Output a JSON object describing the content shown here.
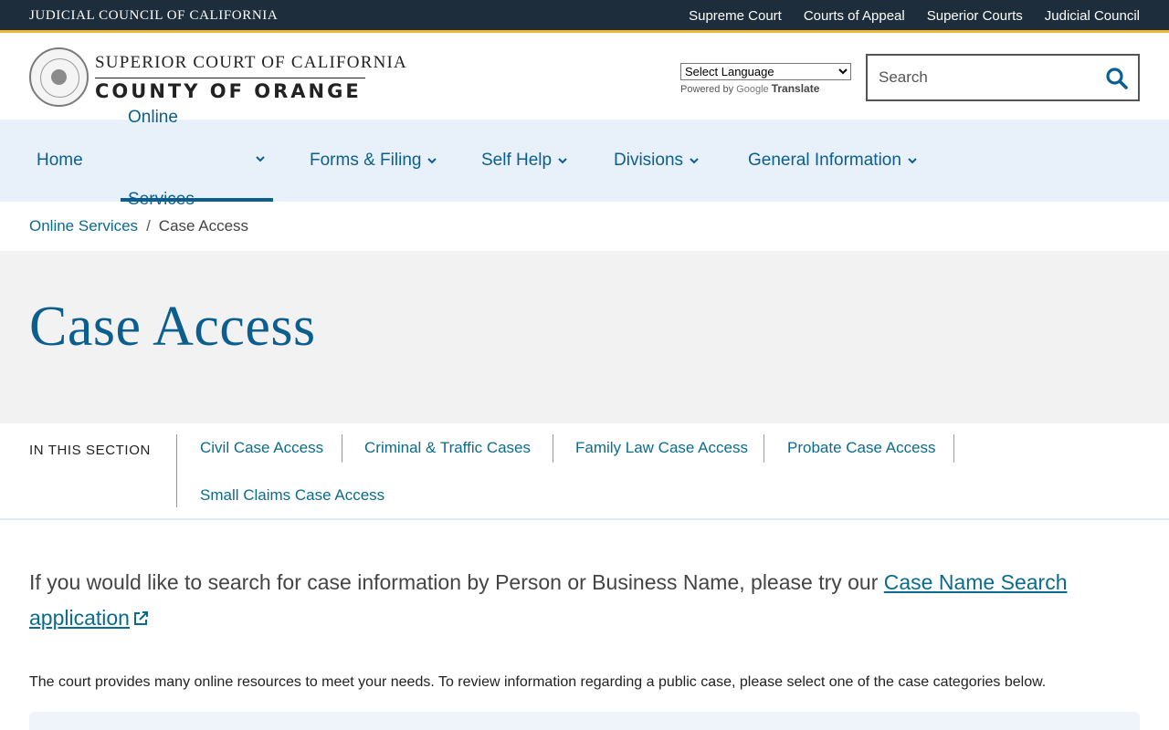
{
  "topbar": {
    "title": "JUDICIAL COUNCIL OF CALIFORNIA",
    "links": [
      "Supreme Court",
      "Courts of Appeal",
      "Superior Courts",
      "Judicial Council"
    ]
  },
  "header": {
    "logo_line1": "SUPERIOR COURT OF CALIFORNIA",
    "logo_line2": "COUNTY OF ORANGE",
    "language_select": "Select Language",
    "powered_by": "Powered by",
    "google": "Google",
    "translate": "Translate",
    "search_placeholder": "Search"
  },
  "nav": {
    "items": [
      {
        "label": "Home"
      },
      {
        "label": "Online Services"
      },
      {
        "label": "Forms & Filing"
      },
      {
        "label": "Self Help"
      },
      {
        "label": "Divisions"
      },
      {
        "label": "General Information"
      }
    ]
  },
  "breadcrumb": {
    "parent": "Online Services",
    "separator": "/",
    "current": "Case Access"
  },
  "hero": {
    "title": "Case Access"
  },
  "in_section": {
    "label": "IN THIS SECTION",
    "links": [
      "Civil Case Access",
      "Criminal & Traffic Cases",
      "Family Law Case Access",
      "Probate Case Access",
      "Small Claims Case Access"
    ]
  },
  "content": {
    "lead_text": "If you would like to search for case information by Person or Business Name, please try our ",
    "lead_link": "Case Name Search application",
    "paragraph": "The court provides many online resources to meet your needs. To review information regarding a public case, please select one of the case categories below."
  },
  "colors": {
    "topbar_bg": "#1d2d3c",
    "accent_gold": "#f2b632",
    "brand_blue": "#0b5e8e",
    "nav_bg": "#e8f1f9"
  }
}
